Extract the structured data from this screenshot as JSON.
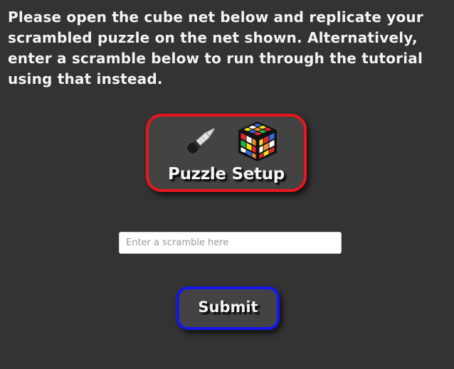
{
  "instructions": {
    "text": "Please open the cube net below and replicate your scrambled puzzle on the net shown. Alternatively, enter a scramble below to run through the tutorial using that instead."
  },
  "setup_button": {
    "label": "Puzzle Setup",
    "icons": [
      "dropper-icon",
      "rubiks-cube-icon"
    ],
    "border_color": "#e8161e"
  },
  "scramble_input": {
    "value": "",
    "placeholder": "Enter a scramble here"
  },
  "submit_button": {
    "label": "Submit",
    "border_color": "#1515ee"
  },
  "colors": {
    "background": "#333333",
    "button_fill": "#434343",
    "text": "#f4f4f4"
  }
}
